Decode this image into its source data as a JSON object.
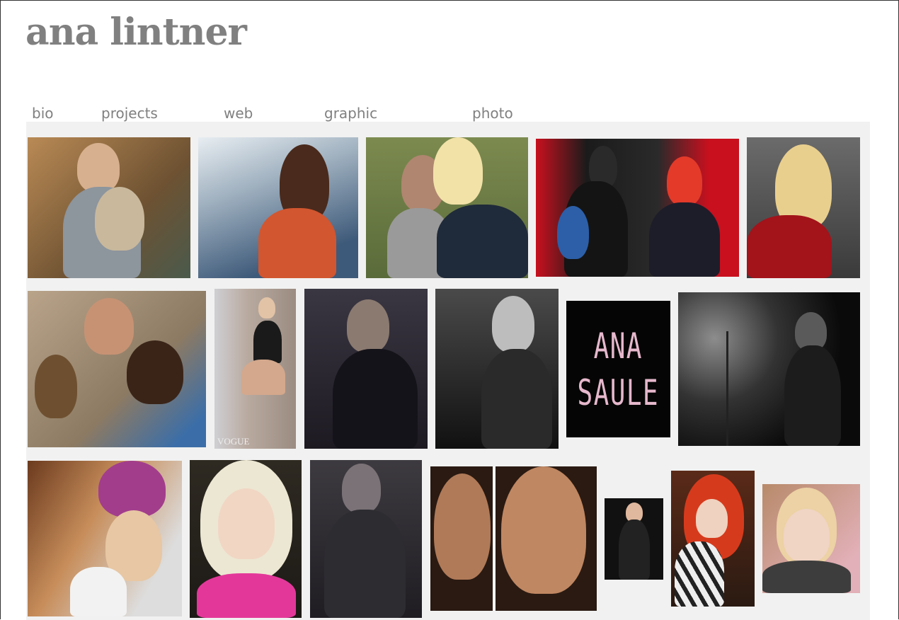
{
  "site": {
    "title": "ana lintner"
  },
  "nav": {
    "bio": "bio",
    "projects": "projects",
    "web": "web",
    "graphic": "graphic",
    "photo": "photo"
  },
  "gallery": {
    "sign_text": "ANA\nSAULE",
    "vogue_text": "VOGUE"
  }
}
